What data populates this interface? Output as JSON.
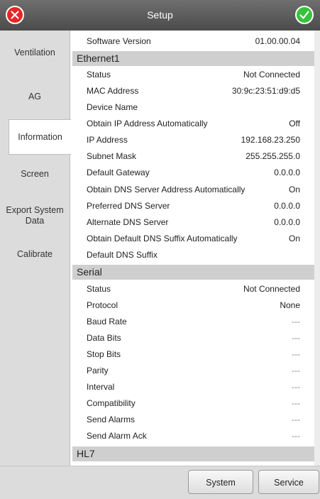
{
  "window": {
    "title": "Setup",
    "accent_cancel": "#e82525",
    "accent_ok": "#39c13b"
  },
  "nav": {
    "items": [
      {
        "label": "Ventilation"
      },
      {
        "label": "AG"
      },
      {
        "label": "Information",
        "active": true
      },
      {
        "label": "Screen"
      },
      {
        "label": "Export System Data"
      },
      {
        "label": "Calibrate"
      }
    ]
  },
  "info": {
    "software_version": {
      "label": "Software Version",
      "value": "01.00.00.04"
    },
    "ethernet": {
      "heading": "Ethernet1",
      "rows": [
        {
          "label": "Status",
          "value": "Not Connected"
        },
        {
          "label": "MAC Address",
          "value": "30:9c:23:51:d9:d5"
        },
        {
          "label": "Device Name",
          "value": ""
        },
        {
          "label": "Obtain IP Address Automatically",
          "value": "Off"
        },
        {
          "label": "IP Address",
          "value": "192.168.23.250"
        },
        {
          "label": "Subnet Mask",
          "value": "255.255.255.0"
        },
        {
          "label": "Default Gateway",
          "value": "0.0.0.0"
        },
        {
          "label": "Obtain DNS Server Address Automatically",
          "value": "On"
        },
        {
          "label": "Preferred DNS Server",
          "value": "0.0.0.0"
        },
        {
          "label": "Alternate DNS Server",
          "value": "0.0.0.0"
        },
        {
          "label": "Obtain Default DNS Suffix Automatically",
          "value": "On"
        },
        {
          "label": "Default DNS Suffix",
          "value": ""
        }
      ]
    },
    "serial": {
      "heading": "Serial",
      "rows": [
        {
          "label": "Status",
          "value": "Not Connected"
        },
        {
          "label": "Protocol",
          "value": "None"
        },
        {
          "label": "Baud Rate",
          "value": "---"
        },
        {
          "label": "Data Bits",
          "value": "---"
        },
        {
          "label": "Stop Bits",
          "value": "---"
        },
        {
          "label": "Parity",
          "value": "---"
        },
        {
          "label": "Interval",
          "value": "---"
        },
        {
          "label": "Compatibility",
          "value": "---"
        },
        {
          "label": "Send Alarms",
          "value": "---"
        },
        {
          "label": "Send Alarm Ack",
          "value": "---"
        }
      ]
    },
    "hl7": {
      "heading": "HL7"
    }
  },
  "footer": {
    "system_label": "System",
    "service_label": "Service"
  }
}
